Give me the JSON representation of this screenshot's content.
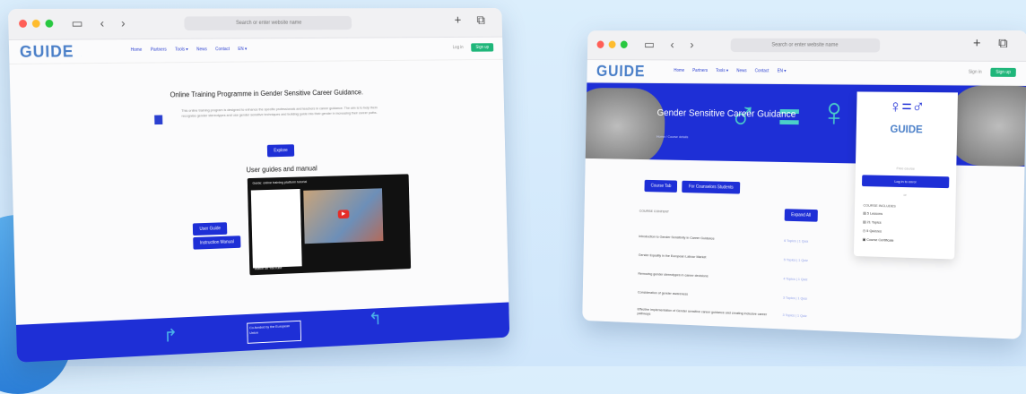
{
  "window1": {
    "address_bar": "Search or enter website name",
    "logo": "GUIDE",
    "nav": [
      "Home",
      "Partners",
      "Tools ▾",
      "News",
      "Contact",
      "EN ▾"
    ],
    "auth": {
      "login": "Log in",
      "signup": "Sign up"
    },
    "heading": "Online Training Programme in Gender Sensitive Career Guidance.",
    "intro": "This online training program is designed to enhance the specific professionals and teachers in career guidance. The aim is to help them recognise gender stereotypes and use gender sensitive techniques and building guide into their gender in increasing their career paths.",
    "explore_button": "Explore",
    "section_title": "User guides and manual",
    "video": {
      "title": "Guide: online training platform tutorial",
      "watch_on": "Watch on YouTube"
    },
    "buttons": {
      "user_guide": "User Guide",
      "manual": "Instruction Manual"
    },
    "eu_badge": "Co-funded by the European Union"
  },
  "window2": {
    "address_bar": "Search or enter website name",
    "logo": "GUIDE",
    "nav": [
      "Home",
      "Partners",
      "Tools ▾",
      "News",
      "Contact",
      "EN ▾"
    ],
    "auth": {
      "login": "Sign in",
      "signup": "Sign up"
    },
    "hero_title": "Gender Sensitive Career Guidance",
    "breadcrumb": "Home / Course details",
    "card": {
      "logo": "GUIDE",
      "price": "Free course",
      "enroll": "Log in to enrol",
      "or": "or",
      "includes_heading": "COURSE INCLUDES",
      "includes": [
        "5 Lessons",
        "21 Topics",
        "5 Quizzes",
        "Course Certificate"
      ]
    },
    "tabs": [
      "Course Tab",
      "For Counselors Students"
    ],
    "course_content": "COURSE CONTENT",
    "expand_all": "Expand All",
    "lessons": [
      {
        "title": "Introduction to Gender Sensitivity in Career Guidance",
        "meta": "6 Topics | 1 Quiz"
      },
      {
        "title": "Gender Equality in the European Labour Market",
        "meta": "5 Topics | 1 Quiz"
      },
      {
        "title": "Removing gender stereotypes in career decisions",
        "meta": "4 Topics | 1 Quiz"
      },
      {
        "title": "Consideration of gender awareness",
        "meta": "3 Topics | 1 Quiz"
      },
      {
        "title": "Effective implementation of Gender sensitive career guidance and creating inclusive career pathways",
        "meta": "3 Topics | 1 Quiz"
      }
    ]
  },
  "colors": {
    "brand_blue": "#1e2fd6",
    "accent_green": "#1fb67a",
    "teal": "#4bd0c8"
  }
}
